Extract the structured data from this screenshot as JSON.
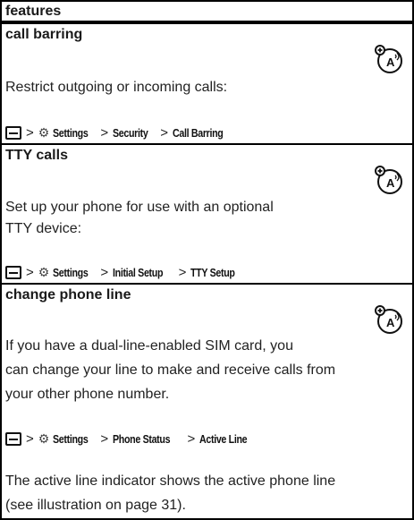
{
  "header": {
    "title": "features"
  },
  "sections": [
    {
      "title": "call barring",
      "icon": "network-feature-icon",
      "body": [
        "Restrict outgoing or incoming calls:"
      ],
      "path": {
        "key": "menu-key-icon",
        "settings_icon": "settings-icon",
        "items": [
          "Settings",
          "Security",
          "Call Barring"
        ],
        "separator": ">"
      }
    },
    {
      "title": "TTY calls",
      "icon": "network-feature-icon",
      "body": [
        "Set up your phone for use with an optional",
        "TTY device:"
      ],
      "path": {
        "key": "menu-key-icon",
        "settings_icon": "settings-icon",
        "items": [
          "Settings",
          "Initial Setup",
          "TTY Setup"
        ],
        "separator": ">"
      }
    },
    {
      "title": "change phone line",
      "icon": "network-feature-icon",
      "body": [
        "If you have a dual-line-enabled SIM card, you",
        "can change your line to make and receive calls from",
        "your other phone number."
      ],
      "path": {
        "key": "menu-key-icon",
        "settings_icon": "settings-icon",
        "items": [
          "Settings",
          "Phone Status",
          "Active Line"
        ],
        "separator": ">"
      },
      "footer": [
        "The active line indicator shows the active phone line",
        "(see illustration on page 31)."
      ]
    }
  ]
}
